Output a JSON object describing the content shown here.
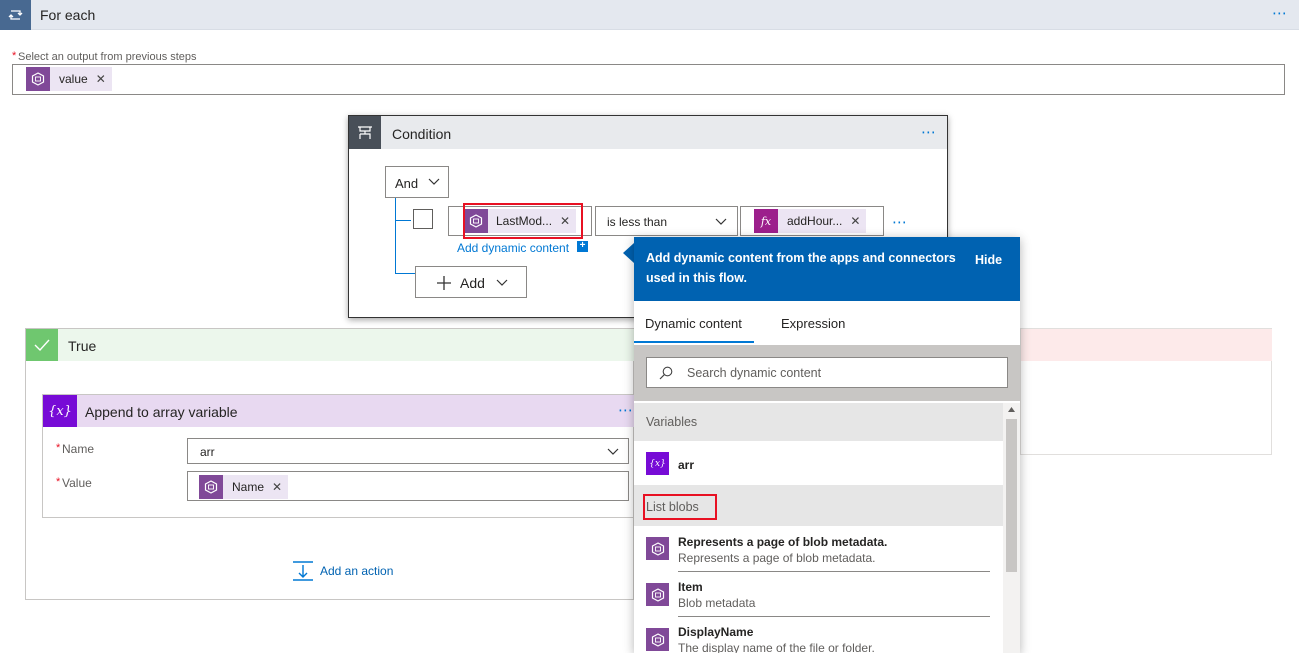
{
  "foreach": {
    "title": "For each",
    "more": "⋯",
    "field_label": "Select an output from previous steps",
    "required_mark": "*",
    "token": "value"
  },
  "condition": {
    "title": "Condition",
    "more": "⋯",
    "group_operator": "And",
    "left_token": "LastMod...",
    "operator": "is less than",
    "right_token": "addHour...",
    "right_token_icon": "fx",
    "add_dynamic": "Add dynamic content",
    "add_dynamic_plus": "+",
    "add_label": "Add",
    "row_more": "⋯"
  },
  "true_branch": {
    "title": "True",
    "add_action": "Add an action"
  },
  "append": {
    "title": "Append to array variable",
    "icon_text": "{x}",
    "more": "⋯",
    "name_label": "Name",
    "name_value": "arr",
    "value_label": "Value",
    "value_token": "Name",
    "required_mark": "*"
  },
  "dynamic_panel": {
    "banner_text_line1": "Add dynamic content from the apps and connectors",
    "banner_text_line2": "used in this flow.",
    "hide": "Hide",
    "tabs": [
      "Dynamic content",
      "Expression"
    ],
    "search_placeholder": "Search dynamic content",
    "section_variables": "Variables",
    "variable_item": "arr",
    "section_list_blobs": "List blobs",
    "items": [
      {
        "title": "Represents a page of blob metadata.",
        "desc": "Represents a page of blob metadata."
      },
      {
        "title": "Item",
        "desc": "Blob metadata"
      },
      {
        "title": "DisplayName",
        "desc": "The display name of the file or folder."
      }
    ]
  },
  "colors": {
    "accent": "#0078d4",
    "banner": "#0062b1",
    "token_bg": "#ece5f3",
    "token_icon": "#804998",
    "variable_icon": "#770bd6",
    "highlight": "#e81123"
  }
}
